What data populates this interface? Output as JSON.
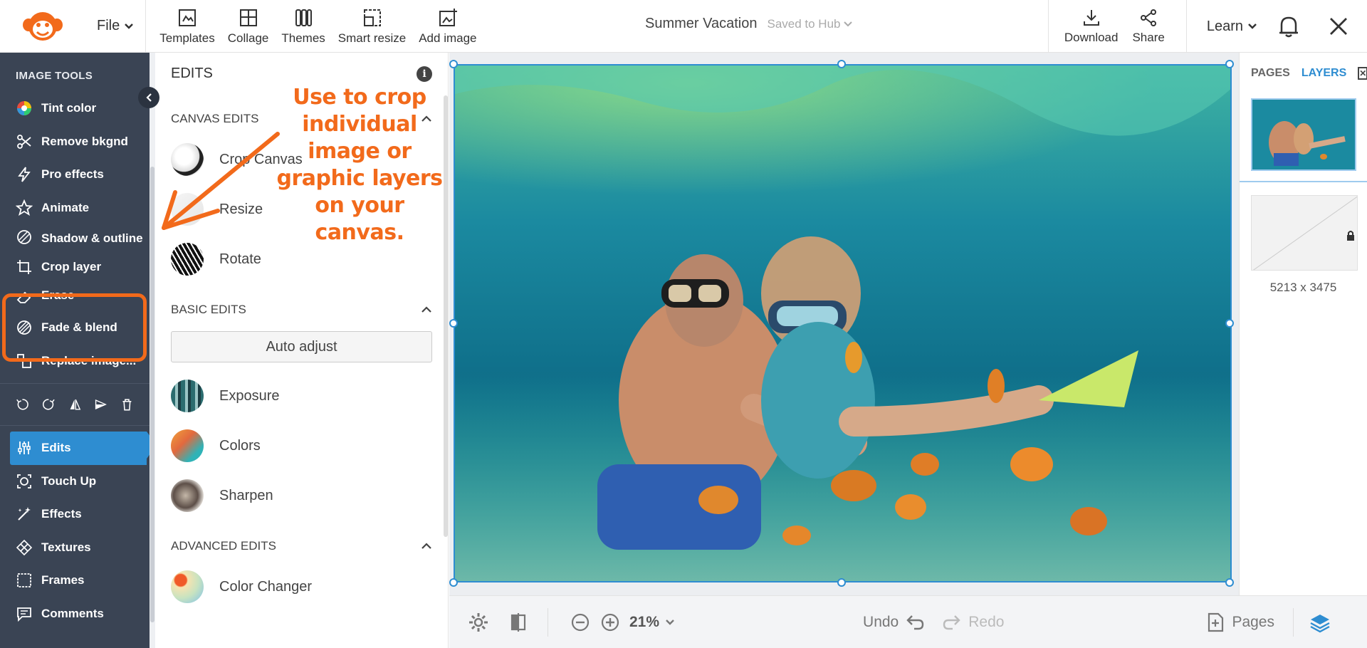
{
  "topbar": {
    "file_label": "File",
    "tools": [
      {
        "label": "Templates",
        "icon": "templates-icon"
      },
      {
        "label": "Collage",
        "icon": "collage-icon"
      },
      {
        "label": "Themes",
        "icon": "themes-icon"
      },
      {
        "label": "Smart resize",
        "icon": "smart-resize-icon"
      },
      {
        "label": "Add image",
        "icon": "add-image-icon"
      }
    ],
    "doc_title": "Summer Vacation",
    "saved_status": "Saved to Hub",
    "download_label": "Download",
    "share_label": "Share",
    "learn_label": "Learn"
  },
  "sidebar": {
    "header": "IMAGE TOOLS",
    "items": [
      {
        "label": "Tint color",
        "icon": "tint-color-icon"
      },
      {
        "label": "Remove bkgnd",
        "icon": "scissors-icon"
      },
      {
        "label": "Pro effects",
        "icon": "lightning-icon"
      },
      {
        "label": "Animate",
        "icon": "star-icon"
      },
      {
        "label": "Shadow & outline",
        "icon": "shadow-icon"
      },
      {
        "label": "Crop layer",
        "icon": "crop-icon"
      },
      {
        "label": "Erase",
        "icon": "eraser-icon"
      },
      {
        "label": "Fade & blend",
        "icon": "fade-icon"
      },
      {
        "label": "Replace image...",
        "icon": "replace-icon"
      }
    ],
    "nav": [
      {
        "label": "Edits",
        "icon": "sliders-icon",
        "active": true
      },
      {
        "label": "Touch Up",
        "icon": "face-icon",
        "active": false
      },
      {
        "label": "Effects",
        "icon": "wand-icon",
        "active": false
      },
      {
        "label": "Textures",
        "icon": "texture-icon",
        "active": false
      },
      {
        "label": "Frames",
        "icon": "frame-icon",
        "active": false
      },
      {
        "label": "Comments",
        "icon": "comment-icon",
        "active": false
      }
    ]
  },
  "edits": {
    "title": "EDITS",
    "canvas_section": "CANVAS EDITS",
    "canvas_items": [
      "Crop Canvas",
      "Resize",
      "Rotate"
    ],
    "basic_section": "BASIC EDITS",
    "auto_adjust": "Auto adjust",
    "basic_items": [
      "Exposure",
      "Colors",
      "Sharpen"
    ],
    "advanced_section": "ADVANCED EDITS",
    "advanced_items": [
      "Color Changer"
    ]
  },
  "annotation": {
    "lines": [
      "Use to crop",
      "individual",
      "image or",
      "graphic layers",
      "on your canvas."
    ],
    "color": "#f26a1b"
  },
  "rightpanel": {
    "tab_pages": "PAGES",
    "tab_layers": "LAYERS",
    "dimensions": "5213 x 3475"
  },
  "bottombar": {
    "zoom": "21%",
    "undo": "Undo",
    "redo": "Redo",
    "pages": "Pages"
  },
  "colors": {
    "accent": "#2e8dd1",
    "sidebar_bg": "#3a4454",
    "highlight": "#f26a1b"
  }
}
